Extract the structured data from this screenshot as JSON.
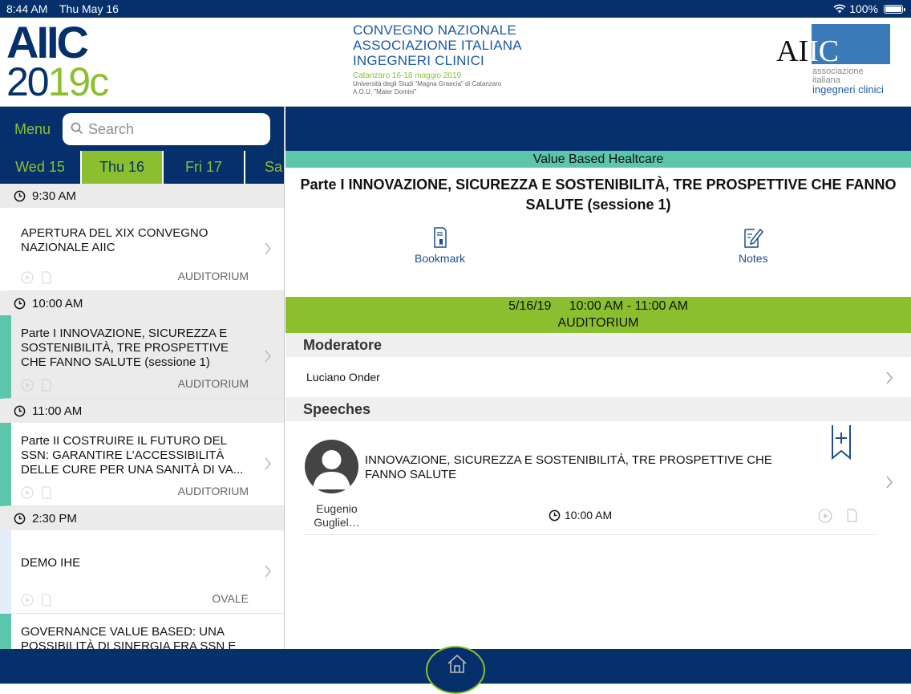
{
  "status": {
    "time": "8:44 AM",
    "date": "Thu May 16",
    "battery": "100%"
  },
  "banner": {
    "logo_left_line1": "AIIC",
    "logo_left_year_a": "20",
    "logo_left_year_b": "19",
    "logo_left_year_c": "c",
    "center_line1": "CONVEGNO NAZIONALE",
    "center_line2": "ASSOCIAZIONE ITALIANA",
    "center_line3": "INGEGNERI CLINICI",
    "center_place": "Catanzaro 16-18 maggio 2019",
    "center_uni": "Università degli Studi \"Magna Graecia\" di Catanzaro",
    "center_aou": "A.O.U. \"Mater Domini\"",
    "logo_right_a": "A",
    "logo_right_b": "I",
    "logo_right_c": "IC",
    "logo_right_sub1": "associazione",
    "logo_right_sub2": "italiana",
    "logo_right_sub3": "ingegneri clinici"
  },
  "sidebar": {
    "menu_label": "Menu",
    "search_placeholder": "Search",
    "days": [
      "Wed 15",
      "Thu 16",
      "Fri 17",
      "Sa"
    ],
    "times": [
      "9:30 AM",
      "10:00 AM",
      "11:00 AM",
      "2:30 PM"
    ],
    "items": [
      {
        "title": "APERTURA DEL XIX CONVEGNO NAZIONALE AIIC",
        "room": "AUDITORIUM"
      },
      {
        "title": "Parte I INNOVAZIONE, SICUREZZA E SOSTENIBILITÀ, TRE PROSPETTIVE CHE FANNO SALUTE (sessione 1)",
        "room": "AUDITORIUM"
      },
      {
        "title": "Parte II COSTRUIRE IL FUTURO DEL SSN: GARANTIRE L’ACCESSIBILITÀ DELLE CURE PER UNA SANITÀ DI VA...",
        "room": "AUDITORIUM"
      },
      {
        "title": "DEMO IHE",
        "room": "OVALE"
      },
      {
        "title": "GOVERNANCE VALUE BASED: UNA POSSIBILITÀ DI SINERGIA FRA SSN E",
        "room": ""
      }
    ]
  },
  "detail": {
    "track": "Value Based Healtcare",
    "title": "Parte I INNOVAZIONE, SICUREZZA E SOSTENIBILITÀ, TRE PROSPETTIVE CHE FANNO SALUTE (sessione 1)",
    "bookmark_label": "Bookmark",
    "notes_label": "Notes",
    "date": "5/16/19",
    "time_range": "10:00 AM - 11:00 AM",
    "room": "AUDITORIUM",
    "moderator_header": "Moderatore",
    "moderator_name": "Luciano Onder",
    "speeches_header": "Speeches",
    "speech": {
      "title": "INNOVAZIONE, SICUREZZA E SOSTENIBILITÀ, TRE PROSPETTIVE CHE FANNO SALUTE",
      "speaker_line1": "Eugenio",
      "speaker_line2": "Gugliel…",
      "time": "10:00 AM"
    }
  },
  "colors": {
    "navy": "#05306b",
    "green": "#8cbf2f",
    "teal": "#5cc6ad",
    "blue_text": "#1d4f8e"
  },
  "icons": [
    "wifi-icon",
    "battery-icon",
    "search-icon",
    "clock-icon",
    "chevron-right-icon",
    "play-circle-icon",
    "document-icon",
    "bookmark-icon",
    "notes-icon",
    "bookmark-add-icon",
    "home-icon",
    "avatar-placeholder-icon"
  ]
}
